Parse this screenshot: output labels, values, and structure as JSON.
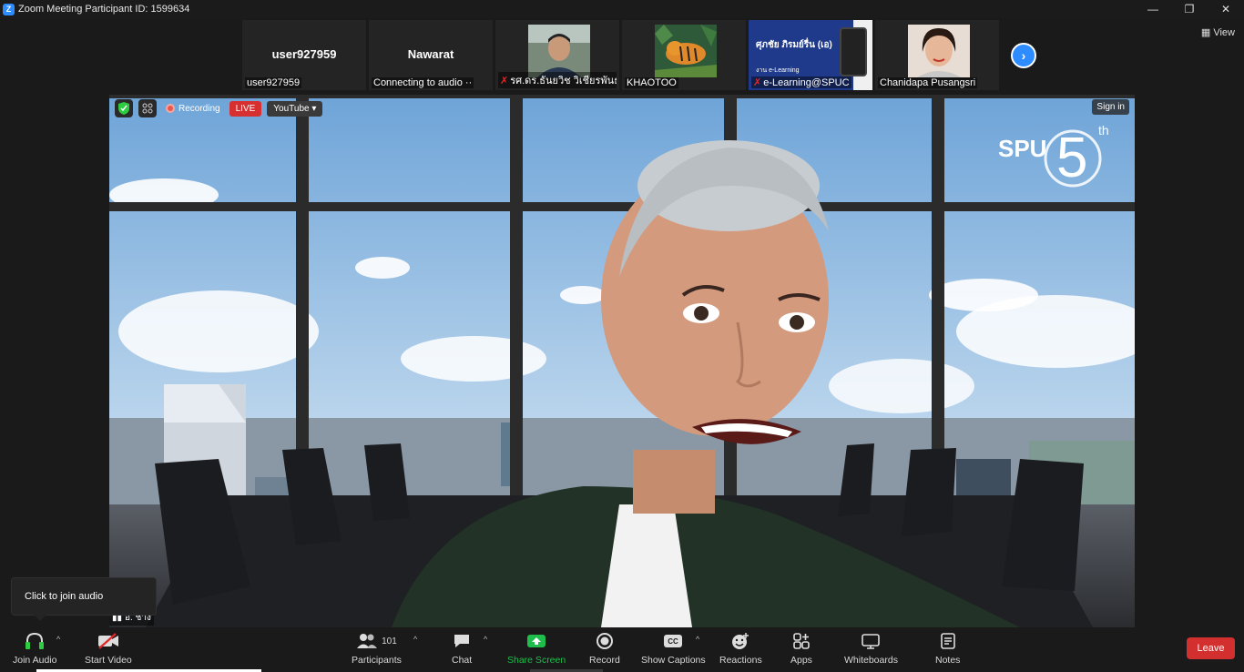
{
  "window": {
    "title": "Zoom Meeting Participant ID: 1599634",
    "app_icon": "Z"
  },
  "strip": {
    "tiles": [
      {
        "big_name": "user927959",
        "label": "user927959",
        "muted": false
      },
      {
        "big_name": "Nawarat",
        "label": "Connecting to audio ··",
        "muted": false
      },
      {
        "big_name": "",
        "label": "รศ.ดร.ธันยวิช วิเชียรพันธ์",
        "muted": true
      },
      {
        "big_name": "",
        "label": "KHAOTOO",
        "muted": false
      },
      {
        "big_name": "",
        "label": "e-Learning@SPUC",
        "muted": true
      },
      {
        "big_name": "",
        "label": "Chanidapa Pusangsri",
        "muted": false
      }
    ],
    "elearning_tile_text": {
      "heading": "ศุภชัย ภิรมย์รื่น (เอ)",
      "sub": "งาน e-Learning"
    },
    "view_label": "View"
  },
  "video": {
    "recording_label": "Recording",
    "live_label": "LIVE",
    "youtube_label": "YouTube",
    "signin_label": "Sign in",
    "logo_text": "SPU",
    "logo_number": "5",
    "logo_suffix": "th",
    "speaker_name": "อ. ช้าง"
  },
  "tooltip": {
    "text": "Click to join audio"
  },
  "toolbar": {
    "join_audio": "Join Audio",
    "start_video": "Start Video",
    "participants": "Participants",
    "participants_count": "101",
    "chat": "Chat",
    "share_screen": "Share Screen",
    "record": "Record",
    "show_captions": "Show Captions",
    "reactions": "Reactions",
    "apps": "Apps",
    "whiteboards": "Whiteboards",
    "notes": "Notes",
    "leave": "Leave"
  },
  "colors": {
    "accent": "#2d8cff",
    "leave": "#d32f2f",
    "live": "#d73030",
    "share": "#1fbd4c"
  }
}
